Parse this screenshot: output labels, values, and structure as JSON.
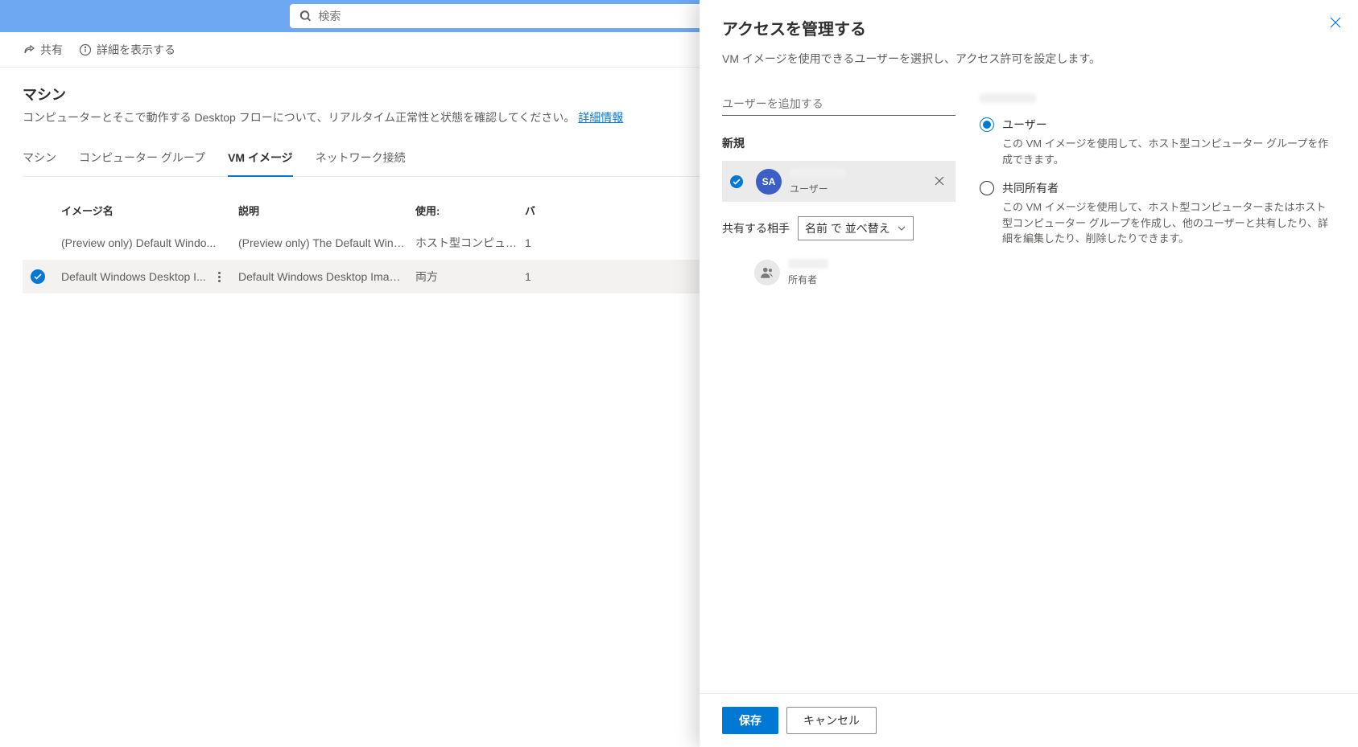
{
  "search": {
    "placeholder": "検索"
  },
  "actions": {
    "share": "共有",
    "details": "詳細を表示する"
  },
  "page": {
    "title": "マシン",
    "description": "コンピューターとそこで動作する Desktop フローについて、リアルタイム正常性と状態を確認してください。",
    "learnMore": "詳細情報"
  },
  "tabs": {
    "machine": "マシン",
    "groups": "コンピューター グループ",
    "vmimage": "VM イメージ",
    "network": "ネットワーク接続"
  },
  "gridHeader": {
    "name": "イメージ名",
    "desc": "説明",
    "use": "使用:",
    "extra": "バ"
  },
  "rows": [
    {
      "name": "(Preview only) Default Windo...",
      "desc": "(Preview only) The Default Windows Desk...",
      "use": "ホスト型コンピュータ...",
      "extra": "1",
      "selected": false
    },
    {
      "name": "Default Windows Desktop I...",
      "desc": "Default Windows Desktop Image for use i...",
      "use": "両方",
      "extra": "1",
      "selected": true
    }
  ],
  "panel": {
    "title": "アクセスを管理する",
    "subtitle": "VM イメージを使用できるユーザーを選択し、アクセス許可を設定します。",
    "addUserPlaceholder": "ユーザーを追加する",
    "newSection": "新規",
    "newUser": {
      "initials": "SA",
      "role": "ユーザー"
    },
    "shareLabel": "共有する相手",
    "sortLabel": "名前 で 並べ替え",
    "ownerRole": "所有者",
    "perms": {
      "user": {
        "label": "ユーザー",
        "desc": "この VM イメージを使用して、ホスト型コンピューター グループを作成できます。"
      },
      "coowner": {
        "label": "共同所有者",
        "desc": "この VM イメージを使用して、ホスト型コンピューターまたはホスト型コンピューター グループを作成し、他のユーザーと共有したり、詳細を編集したり、削除したりできます。"
      }
    },
    "save": "保存",
    "cancel": "キャンセル"
  }
}
